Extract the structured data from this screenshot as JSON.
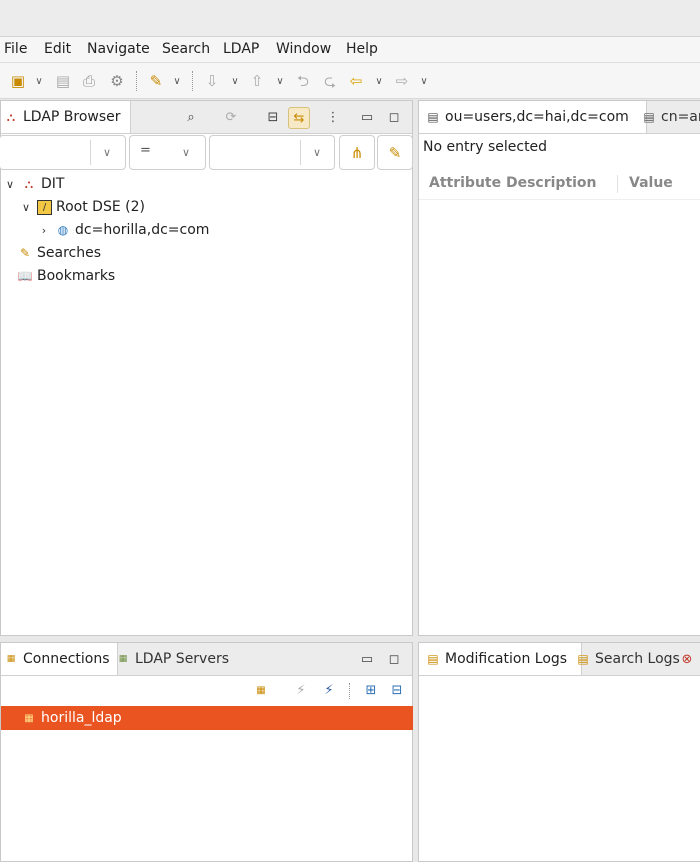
{
  "menu": [
    "File",
    "Edit",
    "Navigate",
    "Search",
    "LDAP",
    "Window",
    "Help"
  ],
  "browser": {
    "tab_label": "LDAP Browser",
    "filter_operator": "=",
    "tree": {
      "dit": "DIT",
      "root_dse": "Root DSE (2)",
      "domain": "dc=horilla,dc=com",
      "searches": "Searches",
      "bookmarks": "Bookmarks"
    }
  },
  "editor": {
    "tabs": [
      "ou=users,dc=hai,dc=com",
      "cn=anu"
    ],
    "status": "No entry selected",
    "columns": [
      "Attribute Description",
      "Value"
    ]
  },
  "connections": {
    "tabs": [
      "Connections",
      "LDAP Servers"
    ],
    "items": [
      "horilla_ldap"
    ]
  },
  "logs": {
    "tabs": [
      "Modification Logs",
      "Search Logs"
    ]
  },
  "colors": {
    "selection": "#e95420"
  }
}
